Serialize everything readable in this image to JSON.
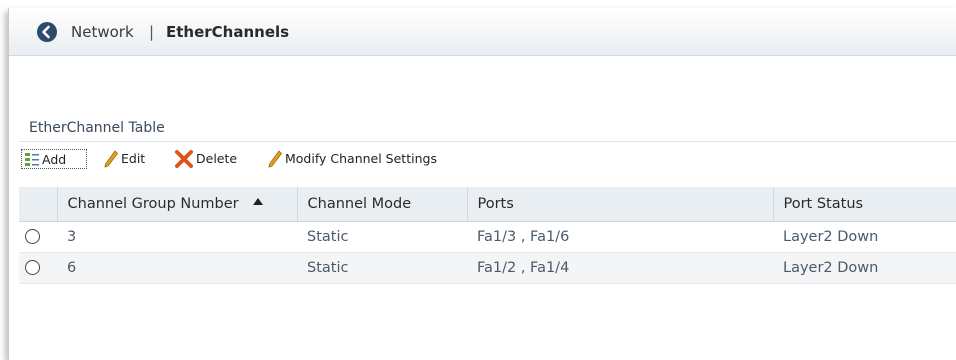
{
  "breadcrumb": {
    "parent": "Network",
    "separator": "|",
    "current": "EtherChannels"
  },
  "table_title": "EtherChannel Table",
  "toolbar": {
    "add_label": "Add",
    "edit_label": "Edit",
    "delete_label": "Delete",
    "modify_label": "Modify Channel Settings"
  },
  "table": {
    "columns": [
      "Channel Group Number",
      "Channel Mode",
      "Ports",
      "Port Status"
    ],
    "sort": {
      "column": "Channel Group Number",
      "direction": "ascending"
    },
    "rows": [
      {
        "group": "3",
        "mode": "Static",
        "ports": "Fa1/3 , Fa1/6",
        "status": "Layer2 Down"
      },
      {
        "group": "6",
        "mode": "Static",
        "ports": "Fa1/2 , Fa1/4",
        "status": "Layer2 Down"
      }
    ]
  },
  "colors": {
    "header_bg": "#e9edf1",
    "back_button": "#2e4a6b",
    "delete_x": "#e0541b",
    "pencil": "#e0a020"
  },
  "icons": [
    "back-arrow-icon",
    "add-icon",
    "pencil-icon",
    "delete-x-icon",
    "sort-ascending-icon",
    "radio-icon"
  ]
}
